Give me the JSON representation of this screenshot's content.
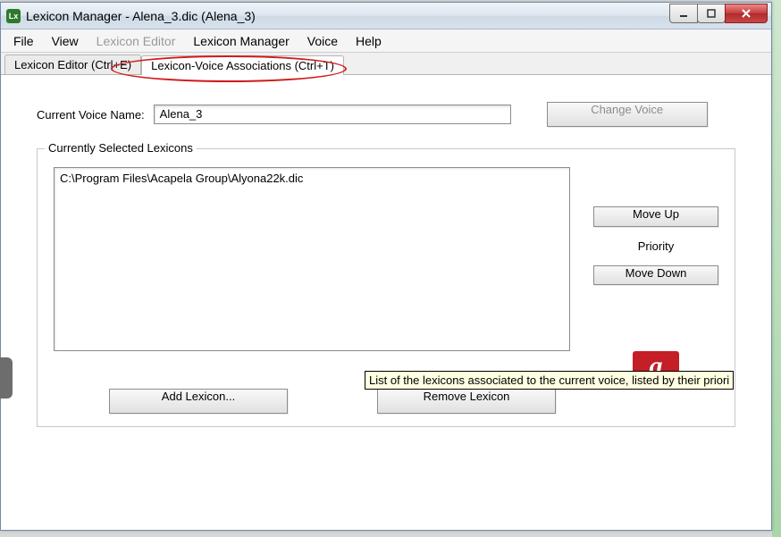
{
  "window": {
    "title": "Lexicon Manager - Alena_3.dic (Alena_3)"
  },
  "menubar": {
    "items": [
      {
        "label": "File",
        "enabled": true
      },
      {
        "label": "View",
        "enabled": true
      },
      {
        "label": "Lexicon Editor",
        "enabled": false
      },
      {
        "label": "Lexicon Manager",
        "enabled": true
      },
      {
        "label": "Voice",
        "enabled": true
      },
      {
        "label": "Help",
        "enabled": true
      }
    ]
  },
  "tabs": {
    "editor": "Lexicon Editor (Ctrl+E)",
    "associations": "Lexicon-Voice Associations (Ctrl+T)"
  },
  "voice": {
    "label": "Current Voice Name:",
    "value": "Alena_3",
    "change_btn": "Change Voice"
  },
  "group": {
    "legend": "Currently Selected Lexicons",
    "list_items": [
      "C:\\Program Files\\Acapela Group\\Alyona22k.dic"
    ],
    "move_up": "Move Up",
    "priority_label": "Priority",
    "move_down": "Move Down",
    "add_btn": "Add Lexicon...",
    "remove_btn": "Remove Lexicon"
  },
  "tooltip": "List of the lexicons associated to the current voice, listed by their priori",
  "logo_letter": "a"
}
